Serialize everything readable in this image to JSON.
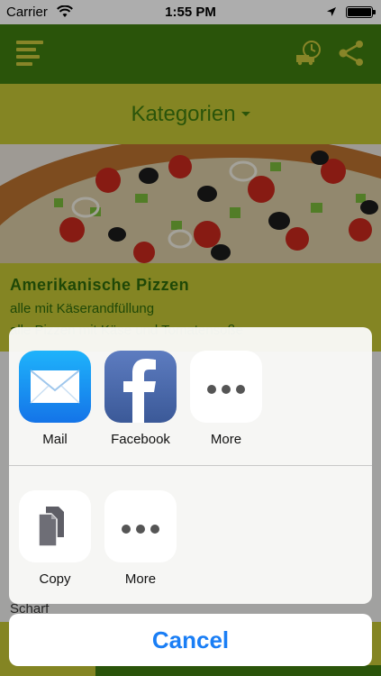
{
  "status_bar": {
    "carrier": "Carrier",
    "time": "1:55 PM"
  },
  "header": {
    "menu_icon": "hamburger-menu-icon",
    "delivery_icon": "delivery-truck-clock-icon",
    "share_icon": "share-icon",
    "color": "#3f7d0f"
  },
  "category": {
    "title": "Kategorien",
    "color": "#c3c534"
  },
  "item": {
    "title": "Amerikanische Pizzen",
    "subtitle": "alle mit Käserandfüllung",
    "line3": "alle Pizzen mit Käse und Tomatensoße",
    "footer_label": "Scharf"
  },
  "share_sheet": {
    "apps": [
      {
        "label": "Mail",
        "icon": "mail-icon"
      },
      {
        "label": "Facebook",
        "icon": "facebook-icon"
      },
      {
        "label": "More",
        "icon": "more-icon"
      }
    ],
    "actions": [
      {
        "label": "Copy",
        "icon": "copy-icon"
      },
      {
        "label": "More",
        "icon": "more-icon"
      }
    ],
    "cancel_label": "Cancel",
    "accent_color": "#1a7ef5"
  }
}
